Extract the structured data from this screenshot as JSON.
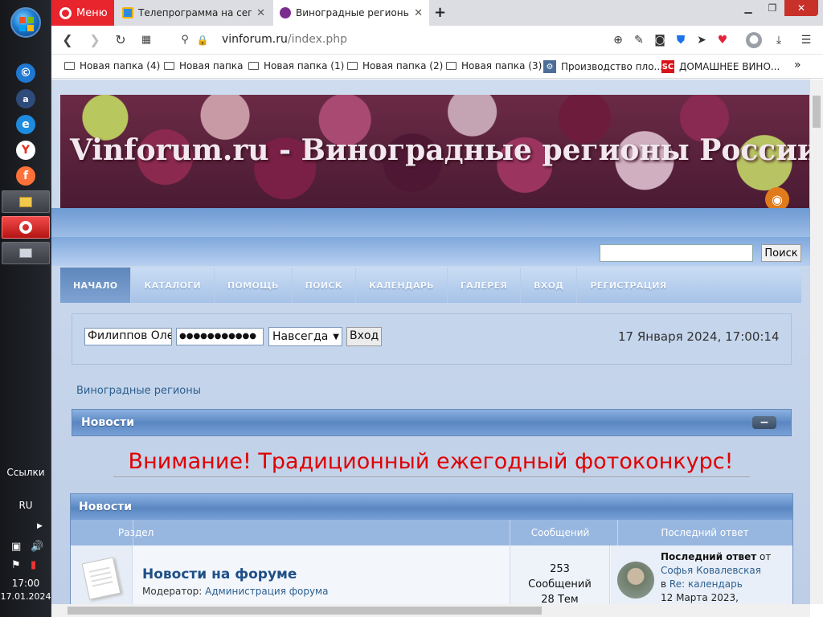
{
  "taskbar": {
    "links_label": "Ссылки",
    "lang": "RU",
    "time": "17:00",
    "date": "17.01.2024"
  },
  "browser": {
    "menu_label": "Меню",
    "tabs": [
      {
        "title": "Телепрограмма на сегодня",
        "favicon": "tv-icon",
        "active": false
      },
      {
        "title": "Виноградные регионы - Виноградные регионы России и ...",
        "favicon": "grape-icon",
        "active": true
      }
    ],
    "url_host": "vinforum.ru",
    "url_path": "/index.php",
    "bookmarks": [
      {
        "label": "Новая папка (4)",
        "type": "folder"
      },
      {
        "label": "Новая папка",
        "type": "folder"
      },
      {
        "label": "Новая папка (1)",
        "type": "folder"
      },
      {
        "label": "Новая папка (2)",
        "type": "folder"
      },
      {
        "label": "Новая папка (3)",
        "type": "folder"
      },
      {
        "label": "Производство пло...",
        "type": "site"
      },
      {
        "label": "ДОМАШНЕЕ ВИНО...",
        "type": "site",
        "badge": "SC"
      }
    ],
    "more": "»"
  },
  "site": {
    "banner_title": "Vinforum.ru - Виноградные регионы России и",
    "search_button": "Поиск",
    "search_value": "",
    "nav": [
      {
        "label": "НАЧАЛО",
        "active": true
      },
      {
        "label": "КАТАЛОГИ",
        "active": false
      },
      {
        "label": "ПОМОЩЬ",
        "active": false
      },
      {
        "label": "ПОИСК",
        "active": false
      },
      {
        "label": "КАЛЕНДАРЬ",
        "active": false
      },
      {
        "label": "ГАЛЕРЕЯ",
        "active": false
      },
      {
        "label": "ВХОД",
        "active": false
      },
      {
        "label": "РЕГИСТРАЦИЯ",
        "active": false
      }
    ],
    "login": {
      "username": "Филиппов Олег",
      "password": "●●●●●●●●●●●",
      "duration": "Навсегда",
      "button": "Вход",
      "datetime": "17 Января 2024, 17:00:14"
    },
    "breadcrumb": "Виноградные регионы",
    "news_category": {
      "title": "Новости",
      "collapse": "−"
    },
    "announcement": "Внимание! Традиционный ежегодный фотоконкурс!",
    "board": {
      "title": "Новости",
      "columns": {
        "section": "Раздел",
        "posts": "Сообщений",
        "last": "Последний ответ"
      },
      "rows": [
        {
          "name": "Новости на форуме",
          "moderator_label": "Модератор:",
          "moderator": "Администрация форума",
          "posts": "253",
          "posts_label": "Сообщений",
          "topics": "28 Тем",
          "last_label": "Последний ответ",
          "last_from": "от",
          "last_author": "Софья Ковалевская",
          "last_in": "в",
          "last_topic": "Re: календарь",
          "last_date": "12 Марта 2023,"
        }
      ]
    }
  }
}
